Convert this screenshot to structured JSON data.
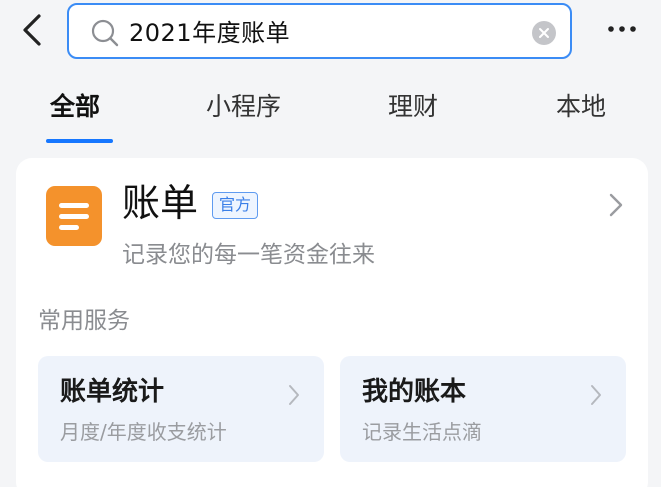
{
  "search": {
    "query": "2021年度账单"
  },
  "tabs": [
    {
      "label": "全部",
      "active": true
    },
    {
      "label": "小程序",
      "active": false
    },
    {
      "label": "理财",
      "active": false
    },
    {
      "label": "本地",
      "active": false
    }
  ],
  "result": {
    "title": "账单",
    "badge": "官方",
    "subtitle": "记录您的每一笔资金往来",
    "section_title": "常用服务",
    "services": [
      {
        "title": "账单统计",
        "subtitle": "月度/年度收支统计"
      },
      {
        "title": "我的账本",
        "subtitle": "记录生活点滴"
      }
    ]
  },
  "colors": {
    "accent": "#1677ff",
    "search_border": "#3b8cf5",
    "app_icon": "#f4922c",
    "service_bg": "#eef3fb"
  },
  "icons": {
    "back": "chevron-left-icon",
    "search": "search-icon",
    "clear": "clear-icon",
    "more": "more-icon",
    "app": "bill-icon",
    "chevron": "chevron-right-icon"
  }
}
